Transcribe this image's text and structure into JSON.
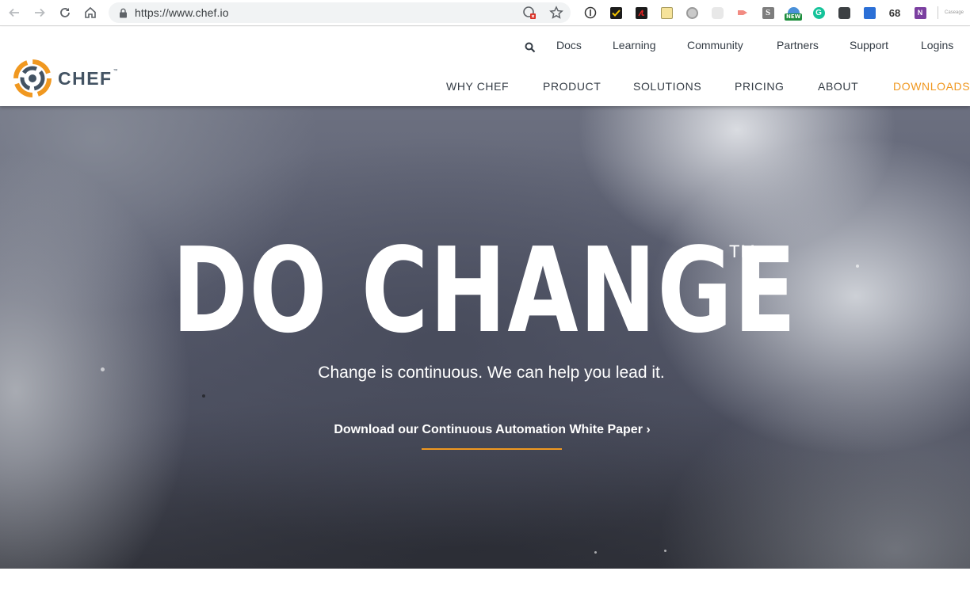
{
  "browser": {
    "url": "https://www.chef.io",
    "extensions_count": "68",
    "new_badge": "NEW",
    "tiny_label": "Caseage"
  },
  "header": {
    "logo_text": "CHEF",
    "logo_tm": "™",
    "utility_nav": [
      "Docs",
      "Learning",
      "Community",
      "Partners",
      "Support",
      "Logins"
    ],
    "main_nav": [
      "WHY CHEF",
      "PRODUCT",
      "SOLUTIONS",
      "PRICING",
      "ABOUT",
      "DOWNLOADS"
    ]
  },
  "hero": {
    "title": "DO CHANGE",
    "trademark": "TM",
    "subtitle": "Change is continuous. We can help you lead it.",
    "cta": "Download our Continuous Automation White Paper ›"
  },
  "colors": {
    "accent": "#f09820",
    "logo_orange": "#f09820",
    "logo_blue": "#435363",
    "nav_text": "#333b44"
  }
}
